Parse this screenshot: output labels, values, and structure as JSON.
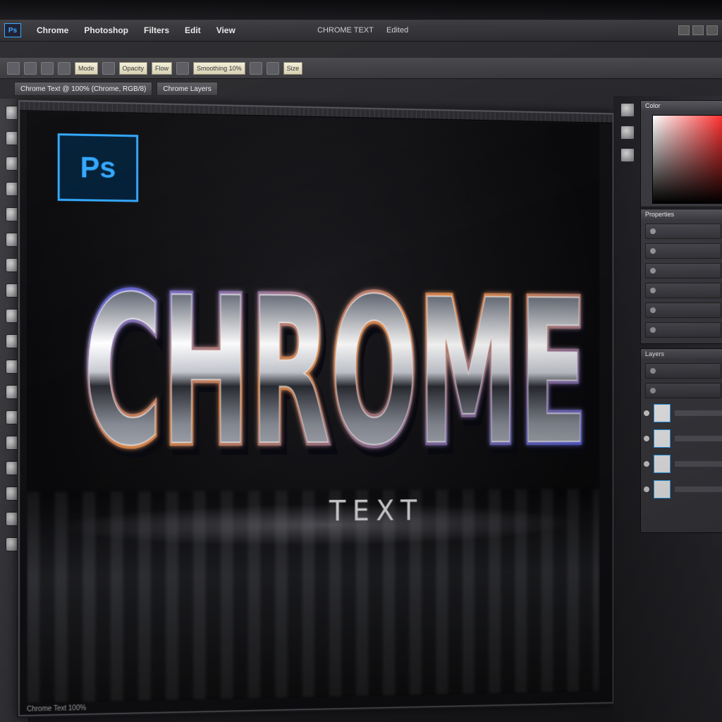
{
  "app": {
    "logo": "Ps",
    "menu": [
      "Ps",
      "Chrome",
      "Photoshop",
      "Filters",
      "Edit",
      "View"
    ],
    "doc_title": "CHROME TEXT",
    "doc_sub": "Edited"
  },
  "tabs": [
    "Chrome Text @ 100% (Chrome, RGB/8)",
    "Chrome Layers"
  ],
  "options": {
    "fields": [
      "Mode",
      "Opacity",
      "Flow",
      "Smoothing 10%",
      "Size"
    ]
  },
  "canvas": {
    "badge": "Ps",
    "main_word": "CHROME",
    "sub_word": "TEXT",
    "status": "Chrome Text 100%"
  },
  "panels": {
    "color_title": "Color",
    "adjust_title": "Properties",
    "layers_title": "Layers",
    "layer_count": 4
  },
  "colors": {
    "accent": "#31a8ff",
    "badge_bg": "#001e36",
    "chrome_edge": "#3b5bff",
    "chrome_warm": "#e08a4a"
  },
  "icons": [
    "move-icon",
    "marquee-icon",
    "lasso-icon",
    "brush-icon",
    "eraser-icon",
    "gradient-icon",
    "text-icon",
    "shape-icon",
    "hand-icon",
    "zoom-icon"
  ]
}
